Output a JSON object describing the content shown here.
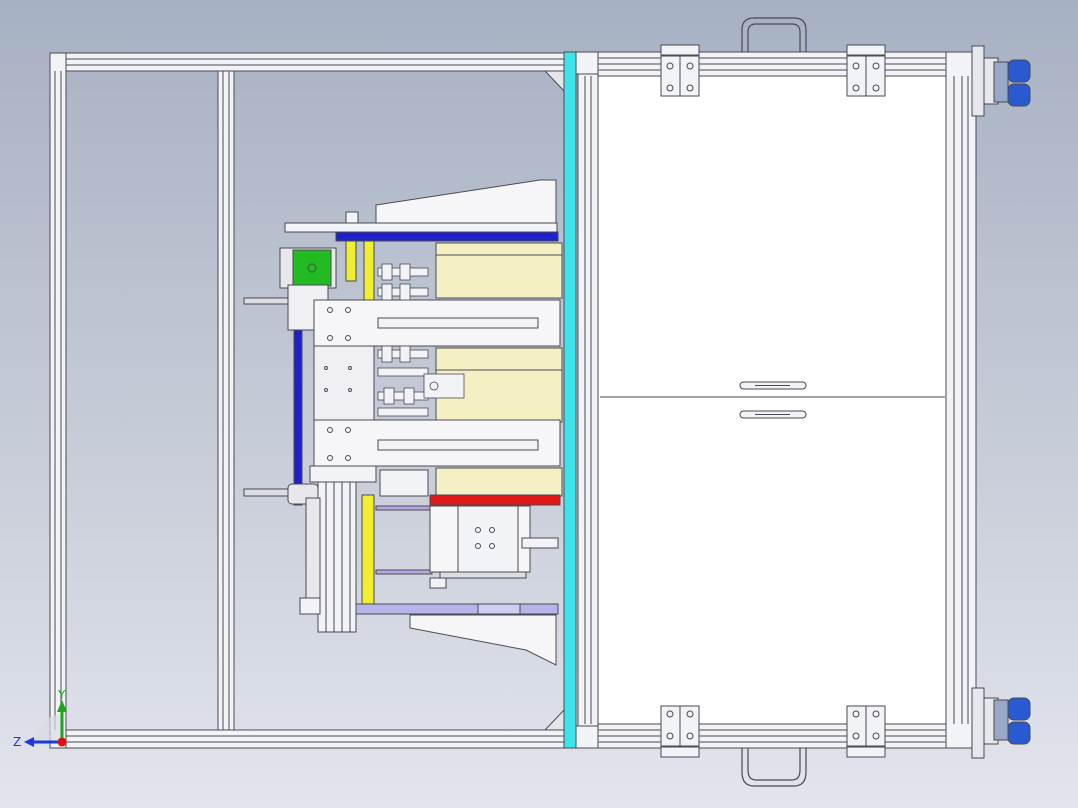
{
  "viewport": {
    "background_top": "#a6b1c3",
    "background_bottom": "#e3e5ec"
  },
  "triad": {
    "y_label": "Y",
    "z_label": "Z",
    "y_color": "#1aa81a",
    "z_color": "#1a3adf",
    "x_color": "#e01010"
  },
  "colors": {
    "frame": "#f2f3f6",
    "frame_edge": "#4a4a52",
    "cyan_rail": "#3ee4ec",
    "blue_belt": "#2020c8",
    "yellow_panel": "#f4f0c4",
    "yellow_bar": "#f0ee30",
    "green_motor": "#22bb22",
    "red_strip": "#e01818",
    "lavender": "#b7b4ea",
    "caster_blue": "#2a5ad0"
  },
  "icons": [
    "axis-triad-icon",
    "caster-wheel-icon",
    "hinge-icon",
    "handle-icon"
  ]
}
